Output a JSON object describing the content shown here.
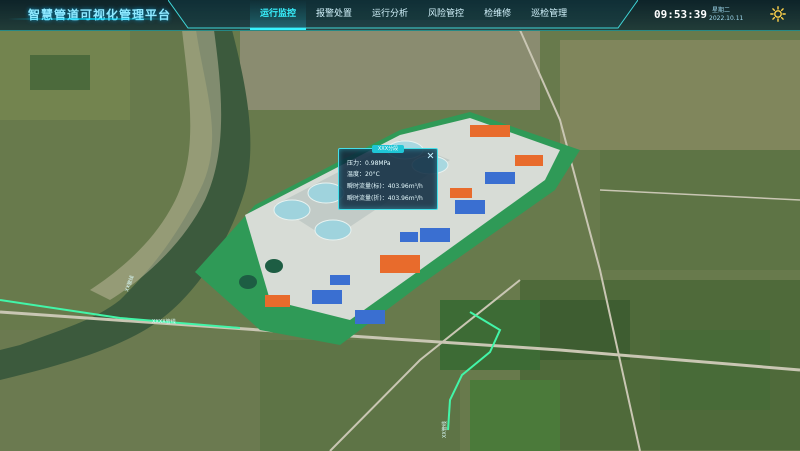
{
  "app": {
    "title": "智慧管道可视化管理平台"
  },
  "nav": {
    "items": [
      {
        "label": "运行监控",
        "active": true
      },
      {
        "label": "报警处置",
        "active": false
      },
      {
        "label": "运行分析",
        "active": false
      },
      {
        "label": "风险管控",
        "active": false
      },
      {
        "label": "检维修",
        "active": false
      },
      {
        "label": "巡检管理",
        "active": false
      }
    ]
  },
  "clock": {
    "time": "09:53:39",
    "weekday": "星期二",
    "date": "2022.10.11"
  },
  "popup": {
    "tab": "XXX分段",
    "metrics": [
      {
        "label": "压力",
        "value": "0.98MPa"
      },
      {
        "label": "温度",
        "value": "20°C"
      },
      {
        "label": "瞬时流量(标)",
        "value": "403.96m³/h"
      },
      {
        "label": "瞬时流量(折)",
        "value": "403.96m³/h"
      }
    ]
  },
  "pipeline": {
    "labels": [
      "XX管线",
      "XXXX管线"
    ]
  },
  "colors": {
    "accent": "#38f2ff",
    "pipe": "#42f5a8",
    "field_green": "#2f9a57"
  }
}
